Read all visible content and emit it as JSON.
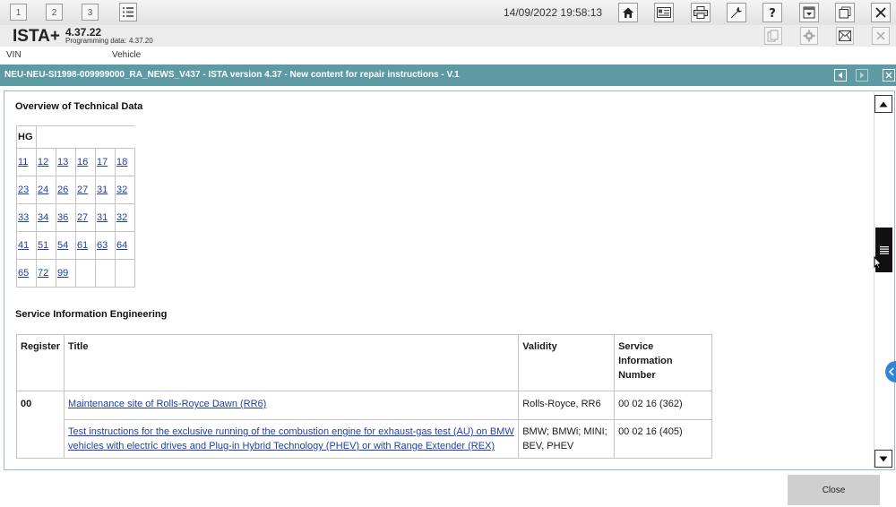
{
  "toolbar": {
    "workspaces": [
      "1",
      "2",
      "3"
    ],
    "datetime": "14/09/2022 19:58:13"
  },
  "app": {
    "name": "ISTA+",
    "version": "4.37.22",
    "programming_label": "Programming data:",
    "programming_value": "4.37.20"
  },
  "vehicle_row": {
    "vin_label": "VIN",
    "vehicle_label": "Vehicle"
  },
  "document": {
    "title": "NEU-NEU-SI1998-009999000_RA_NEWS_V437 - ISTA version 4.37 - New content for repair instructions - V.1"
  },
  "overview": {
    "heading": "Overview of Technical Data",
    "hg_header": "HG",
    "rows": [
      [
        "11",
        "12",
        "13",
        "16",
        "17",
        "18"
      ],
      [
        "23",
        "24",
        "26",
        "27",
        "31",
        "32"
      ],
      [
        "33",
        "34",
        "36",
        "27",
        "31",
        "32"
      ],
      [
        "41",
        "51",
        "54",
        "61",
        "63",
        "64"
      ],
      [
        "65",
        "72",
        "99",
        "",
        "",
        ""
      ]
    ]
  },
  "sie": {
    "heading": "Service Information Engineering",
    "headers": {
      "register": "Register",
      "title": "Title",
      "validity": "Validity",
      "sin": "Service Information Number"
    },
    "rows": [
      {
        "register": "00",
        "title": "Maintenance site of Rolls-Royce Dawn (RR6)",
        "validity": "Rolls-Royce, RR6",
        "sin": "00 02 16 (362)"
      },
      {
        "register": "",
        "title": "Test instructions for the exclusive running of the combustion engine for exhaust-gas test (AU) on BMW vehicles with electric drives and Plug-in Hybrid Technology (PHEV) or with Range Extender (REX)",
        "validity": "BMW; BMWi; MINI; BEV, PHEV",
        "sin": "00 02 16 (405)"
      }
    ]
  },
  "footer": {
    "close_label": "Close"
  },
  "colors": {
    "doc_bar": "#5e9aa3",
    "link": "#1f3fa8",
    "side_tab": "#2f86d6"
  }
}
